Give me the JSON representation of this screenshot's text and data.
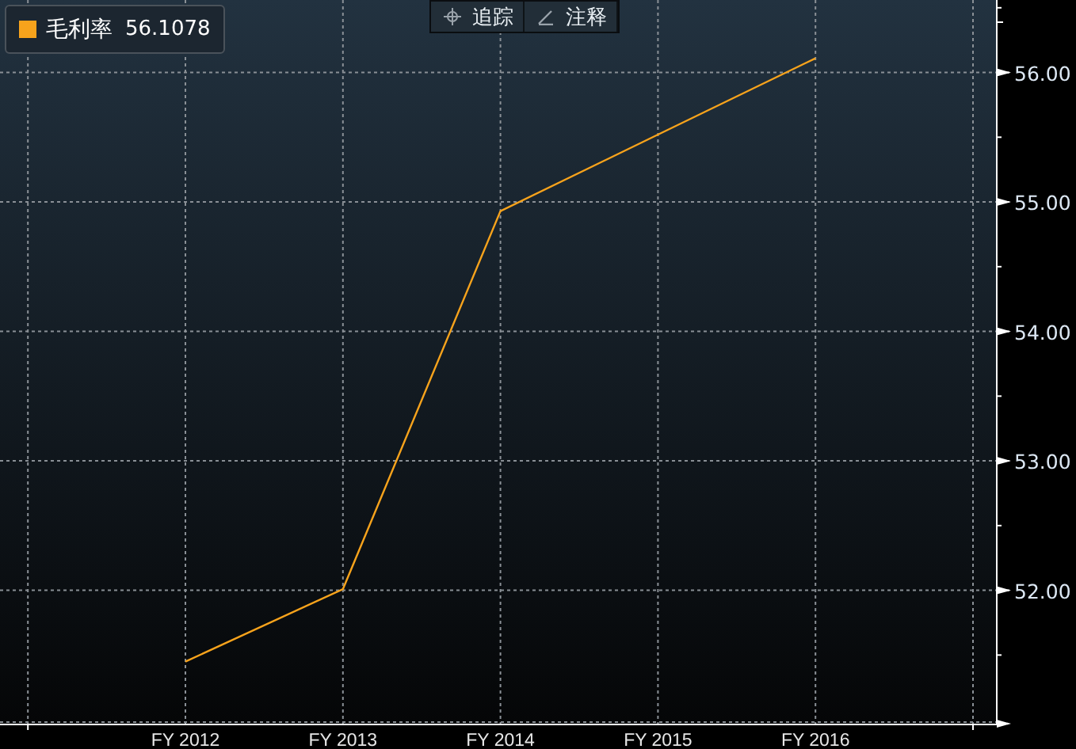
{
  "legend": {
    "value": "56.1078"
  },
  "toolbar": [
    {
      "kind": "crosshair",
      "label": "追踪"
    },
    {
      "kind": "pencil",
      "label": "注释"
    }
  ],
  "chart_data": {
    "type": "line",
    "categories": [
      "FY 2012",
      "FY 2013",
      "FY 2014",
      "FY 2015",
      "FY 2016"
    ],
    "series": [
      {
        "name": "毛利率",
        "color": "#f7a31c",
        "values": [
          51.45,
          52.01,
          54.93,
          55.52,
          56.11
        ]
      }
    ],
    "grid": true,
    "ylim": [
      50.97,
      56.56
    ],
    "yticks": [
      {
        "value": 52,
        "label": "52.00"
      },
      {
        "value": 53,
        "label": "53.00"
      },
      {
        "value": 54,
        "label": "54.00"
      },
      {
        "value": 55,
        "label": "55.00"
      },
      {
        "value": 56,
        "label": "56.00"
      }
    ]
  }
}
